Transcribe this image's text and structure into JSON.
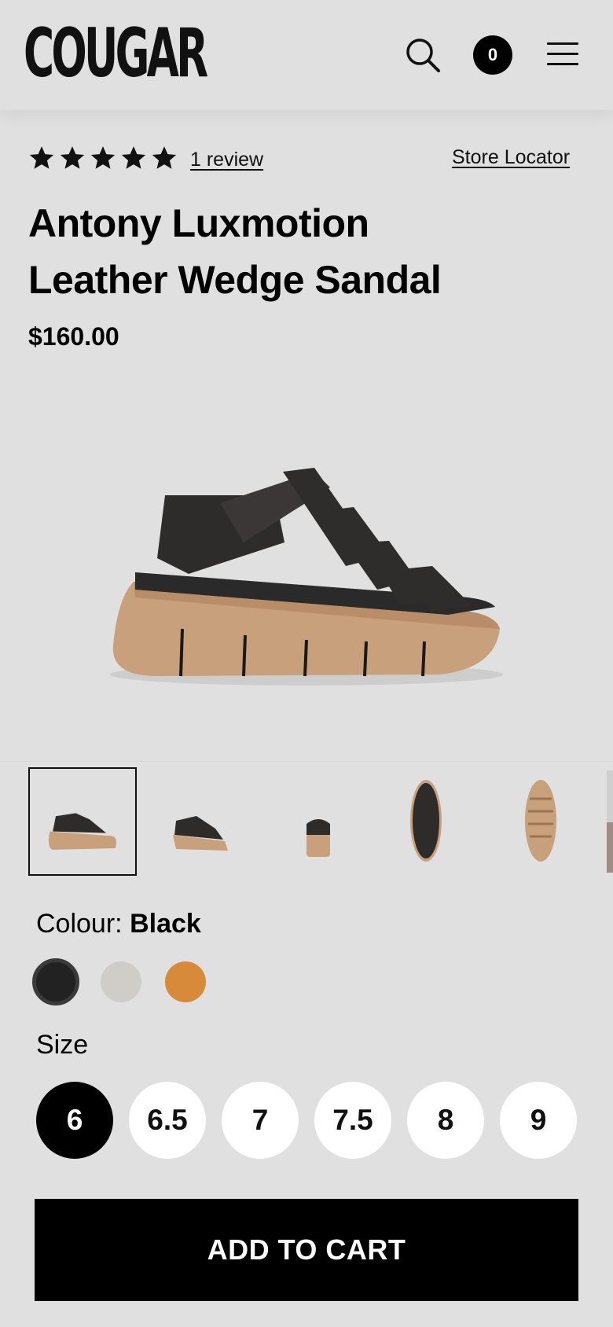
{
  "header": {
    "brand": "COUGAR",
    "cart_count": "0",
    "icons": [
      "search-icon",
      "menu-icon"
    ]
  },
  "product": {
    "rating": 5,
    "review_link": "1 review",
    "store_locator": "Store Locator",
    "title_line1": "Antony Luxmotion",
    "title_line2": "Leather Wedge Sandal",
    "price": "$160.00"
  },
  "gallery": {
    "thumbnail_count": 6,
    "selected_index": 0
  },
  "colour": {
    "label": "Colour:",
    "selected": "Black",
    "swatches": [
      "#222222",
      "#cfcdc8",
      "#d68a3a"
    ]
  },
  "size": {
    "label": "Size",
    "options": [
      "6",
      "6.5",
      "7",
      "7.5",
      "8",
      "9"
    ],
    "selected": "6"
  },
  "cta": {
    "label": "ADD TO CART"
  }
}
